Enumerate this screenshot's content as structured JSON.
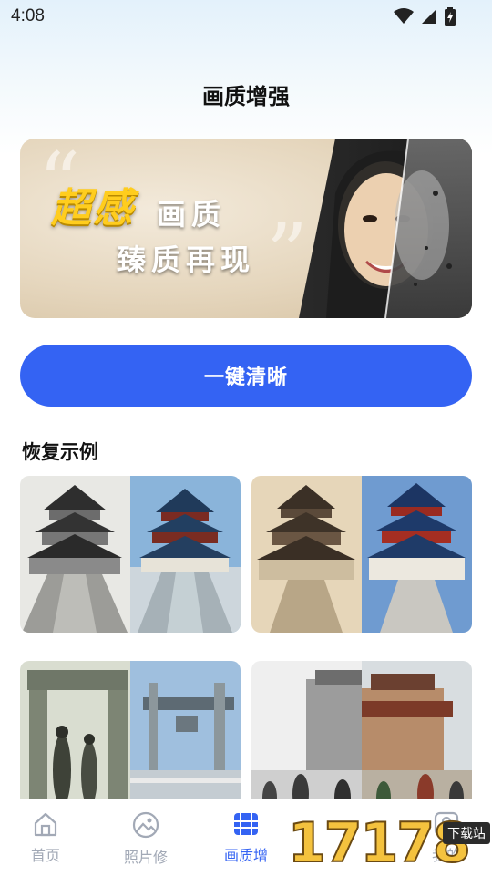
{
  "status_bar": {
    "time": "4:08"
  },
  "header": {
    "title": "画质增强"
  },
  "banner": {
    "line1": "超感",
    "line2": "画质",
    "line3": "臻质再现"
  },
  "actions": {
    "primary_label": "一键清晰"
  },
  "examples": {
    "title": "恢复示例"
  },
  "nav": {
    "items": [
      {
        "label": "首页",
        "icon": "home-icon"
      },
      {
        "label": "照片修",
        "icon": "photo-icon"
      },
      {
        "label": "画质增",
        "icon": "film-icon"
      },
      {
        "label": "我的",
        "icon": "profile-icon"
      }
    ],
    "active": "画质增"
  },
  "watermark": {
    "digits": "17178",
    "tag": "下载站"
  },
  "colors": {
    "accent": "#3463f3",
    "nav_inactive": "#a2a9b6",
    "title_gold": "#ffcd1e"
  }
}
